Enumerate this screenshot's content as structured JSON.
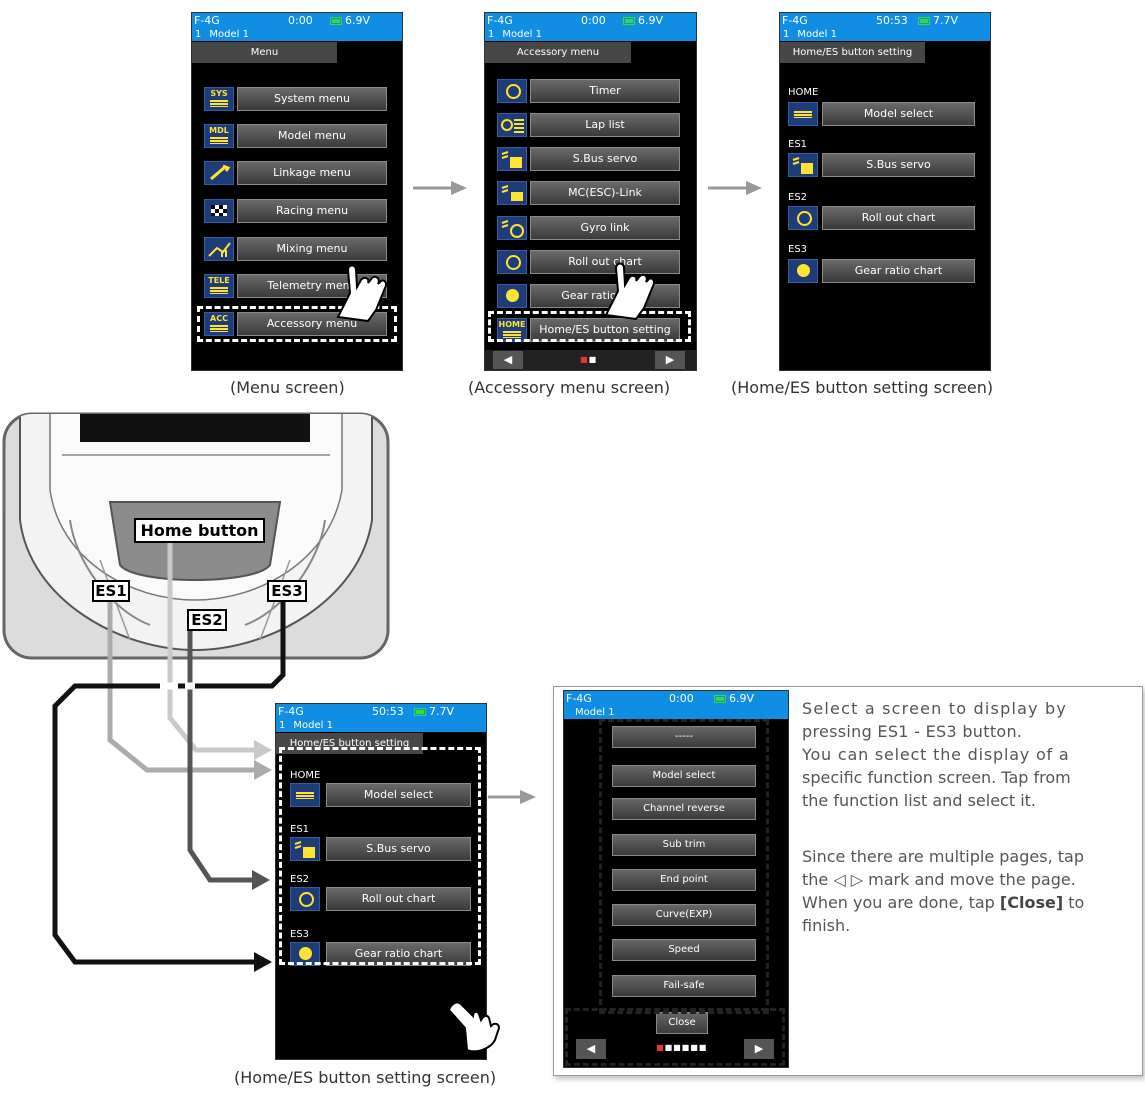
{
  "status": {
    "system": "F-4G",
    "model_num": "1",
    "model_name": "Model 1"
  },
  "screen1": {
    "time": "0:00",
    "voltage": "6.9V",
    "title": "Menu",
    "items": [
      {
        "label": "System menu",
        "icon": "SYS"
      },
      {
        "label": "Model menu",
        "icon": "MDL"
      },
      {
        "label": "Linkage menu",
        "icon": "linkage-icon"
      },
      {
        "label": "Racing menu",
        "icon": "racing-flag-icon"
      },
      {
        "label": "Mixing menu",
        "icon": "mixing-icon"
      },
      {
        "label": "Telemetry menu",
        "icon": "TELE"
      },
      {
        "label": "Accessory menu",
        "icon": "ACC"
      }
    ],
    "caption": "(Menu screen)"
  },
  "screen2": {
    "time": "0:00",
    "voltage": "6.9V",
    "title": "Accessory menu",
    "items": [
      {
        "label": "Timer",
        "icon": "timer-icon"
      },
      {
        "label": "Lap list",
        "icon": "lap-list-icon"
      },
      {
        "label": "S.Bus servo",
        "icon": "sbus-servo-icon"
      },
      {
        "label": "MC(ESC)-Link",
        "icon": "mc-link-icon"
      },
      {
        "label": "Gyro link",
        "icon": "gyro-icon"
      },
      {
        "label": "Roll out chart",
        "icon": "roll-out-icon"
      },
      {
        "label": "Gear ratio chart",
        "icon": "gear-ratio-icon"
      },
      {
        "label": "Home/ES button setting",
        "icon": "HOME"
      }
    ],
    "caption": "(Accessory menu screen)"
  },
  "screen3": {
    "time": "50:53",
    "voltage": "7.7V",
    "title": "Home/ES button setting",
    "sections": [
      {
        "heading": "HOME",
        "label": "Model select"
      },
      {
        "heading": "ES1",
        "label": "S.Bus servo"
      },
      {
        "heading": "ES2",
        "label": "Roll out chart"
      },
      {
        "heading": "ES3",
        "label": "Gear ratio chart"
      }
    ],
    "caption": "(Home/ES button setting screen)"
  },
  "transmitter": {
    "home_label": "Home button",
    "es1": "ES1",
    "es2": "ES2",
    "es3": "ES3"
  },
  "screen4": {
    "time": "50:53",
    "voltage": "7.7V",
    "title": "Home/ES button setting",
    "sections": [
      {
        "heading": "HOME",
        "label": "Model select"
      },
      {
        "heading": "ES1",
        "label": "S.Bus servo"
      },
      {
        "heading": "ES2",
        "label": "Roll out chart"
      },
      {
        "heading": "ES3",
        "label": "Gear ratio chart"
      }
    ],
    "caption": "(Home/ES button setting screen)"
  },
  "screen5": {
    "time": "0:00",
    "voltage": "6.9V",
    "items": [
      "-----",
      "Model select",
      "Channel reverse",
      "Sub trim",
      "End point",
      "Curve(EXP)",
      "Speed",
      "Fail-safe"
    ],
    "close": "Close"
  },
  "description": {
    "p1_line1": "Select a screen to display by",
    "p1_line2": "pressing ES1 - ES3 button.",
    "p2_line1": "You can select the display of a",
    "p2_line2": "specific function screen. Tap from",
    "p2_line3": "the function list and select it.",
    "p3_line1": "Since there are multiple pages, tap",
    "p3_line2": "the ◁ ▷ mark and move the page.",
    "p3_line3a": "When you are done, tap ",
    "p3_close": "[Close]",
    "p3_line3b": " to",
    "p3_line4": "finish."
  },
  "nav": {
    "prev": "◀",
    "next": "▶"
  },
  "colors": {
    "status_blue": "#0f8ee4",
    "icon_yellow": "#ffe233",
    "icon_blue": "#1e3c78"
  }
}
